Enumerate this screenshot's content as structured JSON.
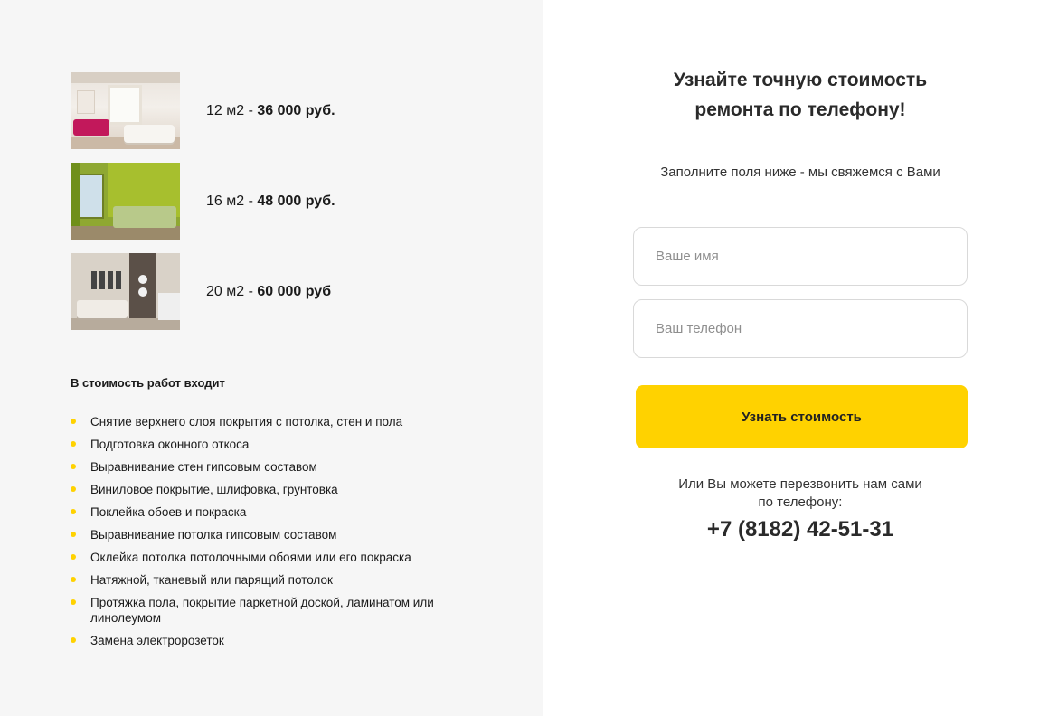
{
  "offers": [
    {
      "area": "12 м2 - ",
      "price": "36 000 руб."
    },
    {
      "area": "16 м2 - ",
      "price": "48 000 руб."
    },
    {
      "area": "20 м2 - ",
      "price": "60 000 руб"
    }
  ],
  "included": {
    "title": "В стоимость работ входит",
    "items": [
      "Снятие верхнего слоя покрытия с потолка, стен и пола",
      "Подготовка оконного откоса",
      "Выравнивание стен гипсовым составом",
      "Виниловое покрытие, шлифовка, грунтовка",
      "Поклейка обоев и покраска",
      "Выравнивание потолка гипсовым составом",
      "Оклейка потолка потолочными обоями или его покраска",
      "Натяжной, тканевый или парящий потолок",
      "Протяжка пола, покрытие паркетной доской, ламинатом или линолеумом",
      "Замена электророзеток"
    ],
    "bullet_color": "#ffd200"
  },
  "form": {
    "title_line1": "Узнайте точную стоимость",
    "title_line2": "ремонта по телефону!",
    "subtitle": "Заполните поля ниже - мы свяжемся с Вами",
    "name_placeholder": "Ваше имя",
    "phone_placeholder": "Ваш телефон",
    "submit_label": "Узнать стоимость",
    "accent_color": "#ffd200"
  },
  "callback": {
    "line1": "Или Вы можете перезвонить нам сами",
    "line2": "по телефону:",
    "phone": "+7 (8182) 42-51-31"
  }
}
